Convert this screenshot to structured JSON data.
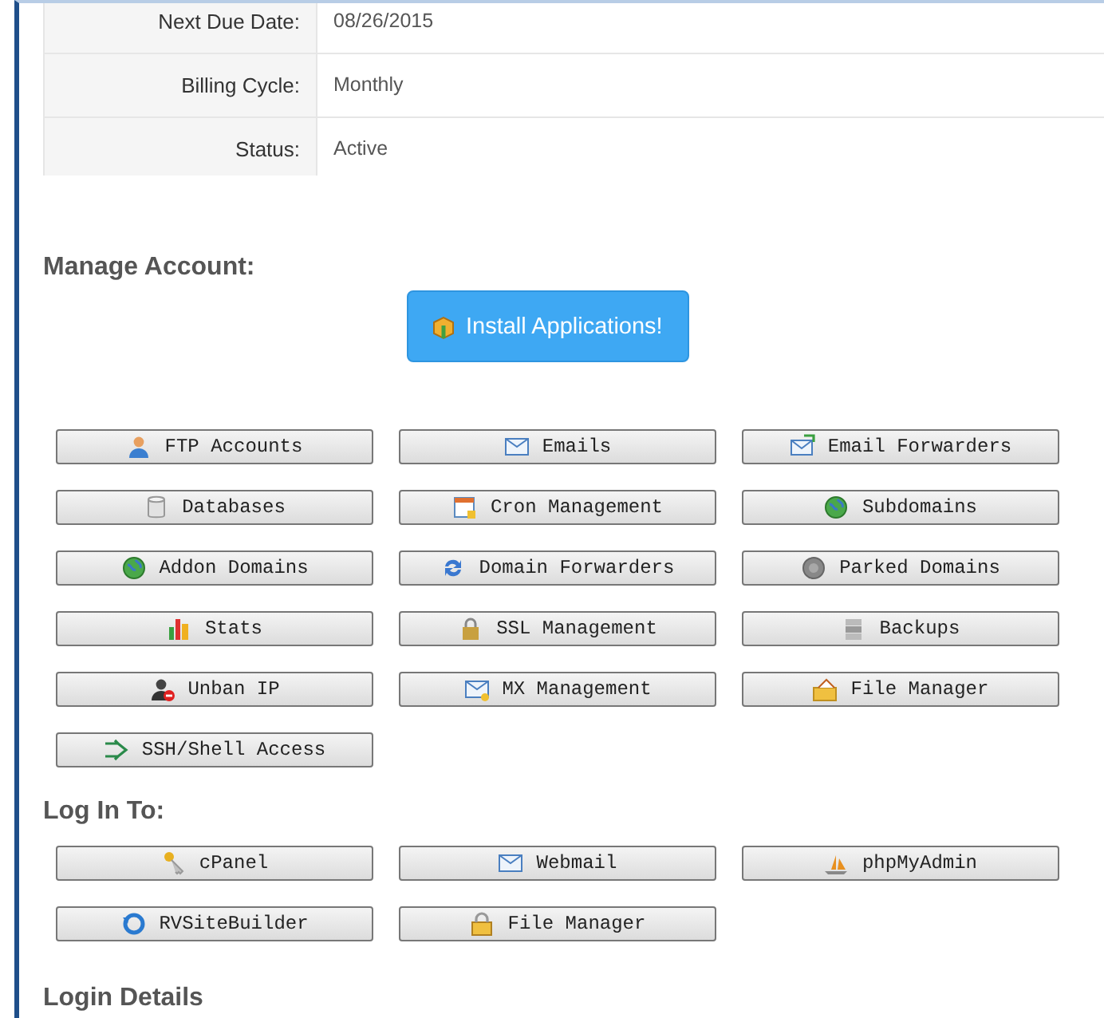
{
  "details": [
    {
      "label": "Next Due Date:",
      "value": "08/26/2015"
    },
    {
      "label": "Billing Cycle:",
      "value": "Monthly"
    },
    {
      "label": "Status:",
      "value": "Active"
    }
  ],
  "manage_account": {
    "heading": "Manage Account:",
    "install_button": "Install Applications!",
    "buttons": [
      "FTP Accounts",
      "Emails",
      "Email Forwarders",
      "Databases",
      "Cron Management",
      "Subdomains",
      "Addon Domains",
      "Domain Forwarders",
      "Parked Domains",
      "Stats",
      "SSL Management",
      "Backups",
      "Unban IP",
      "MX Management",
      "File Manager",
      "SSH/Shell Access"
    ]
  },
  "log_in_to": {
    "heading": "Log In To:",
    "buttons": [
      "cPanel",
      "Webmail",
      "phpMyAdmin",
      "RVSiteBuilder",
      "File Manager"
    ]
  },
  "login_details": {
    "heading": "Login Details"
  }
}
